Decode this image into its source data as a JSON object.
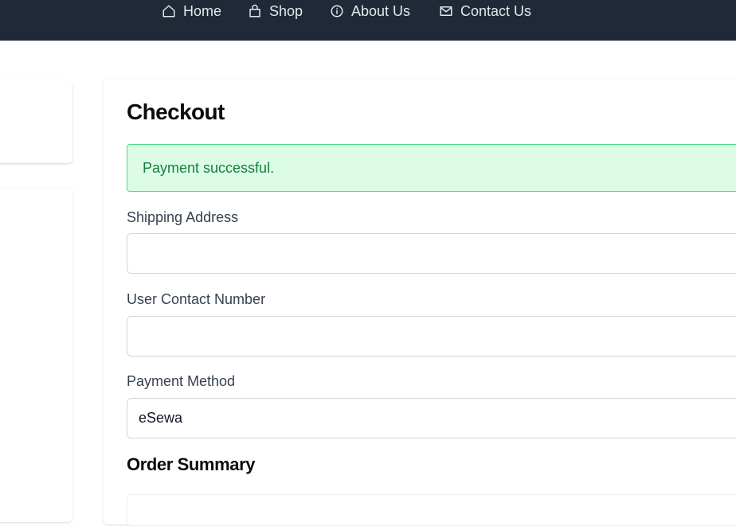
{
  "nav": {
    "items": [
      {
        "label": "Home",
        "icon": "home-icon"
      },
      {
        "label": "Shop",
        "icon": "shopping-bag-icon"
      },
      {
        "label": "About Us",
        "icon": "info-icon"
      },
      {
        "label": "Contact Us",
        "icon": "mail-icon"
      }
    ]
  },
  "checkout": {
    "title": "Checkout",
    "alert": "Payment successful.",
    "shipping_label": "Shipping Address",
    "shipping_value": "",
    "contact_label": "User Contact Number",
    "contact_value": "",
    "payment_label": "Payment Method",
    "payment_value": "eSewa",
    "summary_title": "Order Summary"
  },
  "colors": {
    "nav_bg": "#1f2937",
    "alert_bg": "#dcfce7",
    "alert_border": "#4ade80",
    "alert_text": "#15803d"
  }
}
